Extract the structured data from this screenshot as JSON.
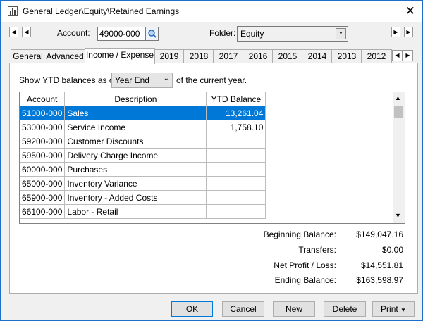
{
  "window": {
    "title": "General Ledger\\Equity\\Retained Earnings",
    "close_glyph": "✕"
  },
  "record_nav": {
    "first_glyph": "◀",
    "prev_glyph": "◀",
    "next_glyph": "▶",
    "last_glyph": "▶"
  },
  "account": {
    "label": "Account:",
    "value": "49000-000"
  },
  "folder": {
    "label": "Folder:",
    "value": "Equity"
  },
  "tabs": [
    {
      "label": "General"
    },
    {
      "label": "Advanced"
    },
    {
      "label": "Income / Expense"
    },
    {
      "label": "2019"
    },
    {
      "label": "2018"
    },
    {
      "label": "2017"
    },
    {
      "label": "2016"
    },
    {
      "label": "2015"
    },
    {
      "label": "2014"
    },
    {
      "label": "2013"
    },
    {
      "label": "2012"
    }
  ],
  "tab_scroll": {
    "left_glyph": "◀",
    "right_glyph": "▶"
  },
  "ytd": {
    "prefix": "Show YTD balances as of",
    "selected": "Year End",
    "suffix": "of the current year."
  },
  "grid": {
    "columns": {
      "account": "Account",
      "description": "Description",
      "ytd": "YTD Balance"
    },
    "rows": [
      {
        "account": "51000-000",
        "description": "Sales",
        "ytd": "13,261.04"
      },
      {
        "account": "53000-000",
        "description": "Service Income",
        "ytd": "1,758.10"
      },
      {
        "account": "59200-000",
        "description": "Customer Discounts",
        "ytd": ""
      },
      {
        "account": "59500-000",
        "description": "Delivery Charge Income",
        "ytd": ""
      },
      {
        "account": "60000-000",
        "description": "Purchases",
        "ytd": ""
      },
      {
        "account": "65000-000",
        "description": "Inventory Variance",
        "ytd": ""
      },
      {
        "account": "65900-000",
        "description": "Inventory - Added Costs",
        "ytd": ""
      },
      {
        "account": "66100-000",
        "description": "Labor - Retail",
        "ytd": ""
      }
    ]
  },
  "summary": {
    "beginning_label": "Beginning Balance:",
    "beginning_value": "$149,047.16",
    "transfers_label": "Transfers:",
    "transfers_value": "$0.00",
    "net_label": "Net Profit / Loss:",
    "net_value": "$14,551.81",
    "ending_label": "Ending Balance:",
    "ending_value": "$163,598.97"
  },
  "buttons": {
    "ok": "OK",
    "cancel": "Cancel",
    "new": "New",
    "delete": "Delete",
    "print_rest": "rint",
    "print_first": "P",
    "print_arrow": "▼"
  },
  "colors": {
    "selection": "#0078d7",
    "window_border": "#1e6fc7"
  }
}
